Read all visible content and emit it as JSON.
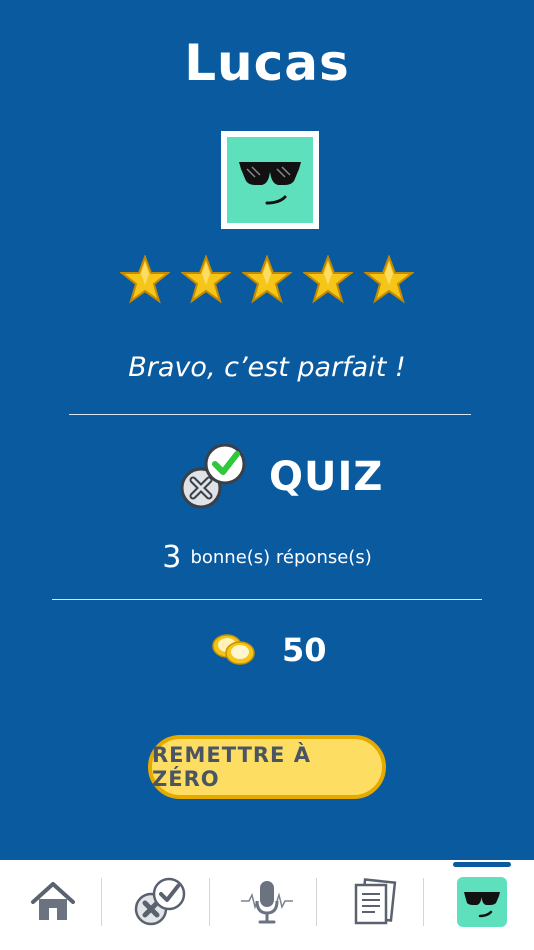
{
  "profile": {
    "name": "Lucas",
    "avatar_icon": "sunglasses-face-icon",
    "rating_stars": 5,
    "rating_max": 5,
    "message": "Bravo, c’est parfait !"
  },
  "quiz": {
    "icon": "check-cross-badge-icon",
    "label": "QUIZ",
    "correct_count": "3",
    "correct_label": "bonne(s) réponse(s)"
  },
  "coins": {
    "icon": "coins-icon",
    "value": "50"
  },
  "reset_button": {
    "label": "REMETTRE À ZÉRO"
  },
  "tabbar": {
    "items": [
      {
        "icon": "home-icon"
      },
      {
        "icon": "quiz-icon"
      },
      {
        "icon": "microphone-icon"
      },
      {
        "icon": "documents-icon"
      },
      {
        "icon": "profile-avatar-icon",
        "active": true
      }
    ]
  },
  "colors": {
    "background": "#0a5aa0",
    "avatar": "#5ee0bd",
    "button": "#fddd62",
    "button_border": "#e6a900",
    "star": "#f5c518"
  }
}
